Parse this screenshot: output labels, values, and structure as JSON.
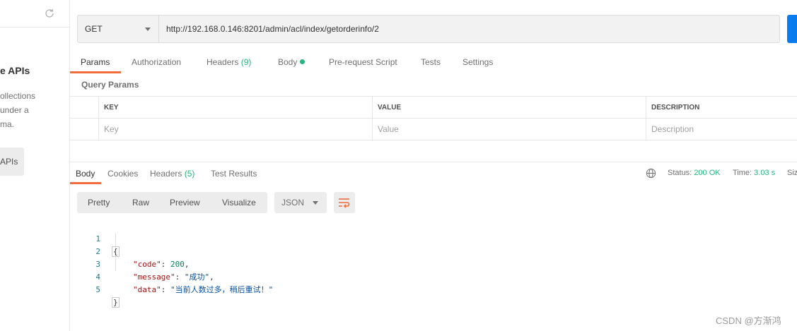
{
  "sidebar": {
    "title": "e APIs",
    "desc_line1": "ollections",
    "desc_line2": "under a",
    "desc_line3": "ma.",
    "button_label": "APIs"
  },
  "request": {
    "method": "GET",
    "url": "http://192.168.0.146:8201/admin/acl/index/getorderinfo/2"
  },
  "request_tabs": {
    "params": "Params",
    "authorization": "Authorization",
    "headers": "Headers",
    "headers_count": "(9)",
    "body": "Body",
    "prerequest": "Pre-request Script",
    "tests": "Tests",
    "settings": "Settings"
  },
  "query_params": {
    "title": "Query Params",
    "columns": [
      "KEY",
      "VALUE",
      "DESCRIPTION"
    ],
    "placeholders": [
      "Key",
      "Value",
      "Description"
    ]
  },
  "response_tabs": {
    "body": "Body",
    "cookies": "Cookies",
    "headers": "Headers",
    "headers_count": "(5)",
    "test_results": "Test Results"
  },
  "response_status": {
    "status_label": "Status:",
    "status_value": "200 OK",
    "time_label": "Time:",
    "time_value": "3.03 s",
    "size_label": "Siz"
  },
  "response_toolbar": {
    "pretty": "Pretty",
    "raw": "Raw",
    "preview": "Preview",
    "visualize": "Visualize",
    "language": "JSON"
  },
  "response_code": {
    "line_numbers": [
      "1",
      "2",
      "3",
      "4",
      "5"
    ],
    "open_brace": "{",
    "close_brace": "}",
    "code_key": "\"code\"",
    "code_value": "200",
    "message_key": "\"message\"",
    "message_value": "\"成功\"",
    "data_key": "\"data\"",
    "data_value": "\"当前人数过多，稍后重试！\""
  },
  "watermark": "CSDN @方渐鸿",
  "colors": {
    "accent_orange": "#f26b3a",
    "success_green": "#26b47f",
    "send_blue": "#097bed"
  }
}
